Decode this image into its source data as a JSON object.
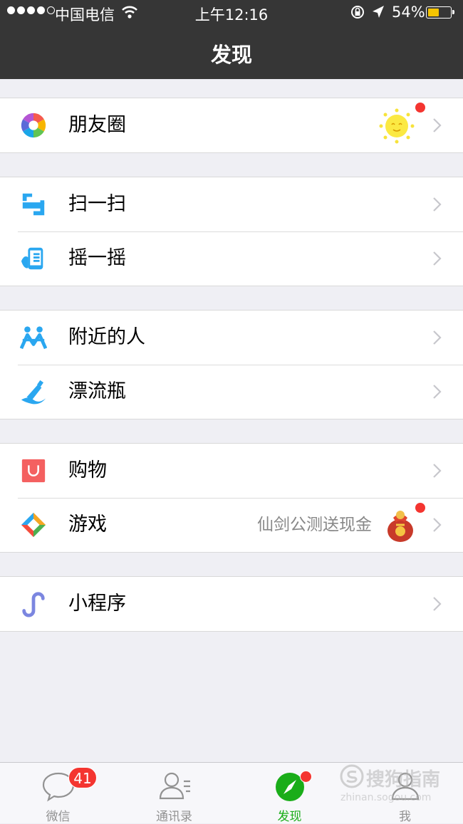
{
  "status_bar": {
    "carrier": "中国电信",
    "time": "上午12:16",
    "battery_percent": "54%",
    "battery_level": 0.54
  },
  "header": {
    "title": "发现"
  },
  "menu": {
    "moments": {
      "label": "朋友圈"
    },
    "scan": {
      "label": "扫一扫"
    },
    "shake": {
      "label": "摇一摇"
    },
    "nearby": {
      "label": "附近的人"
    },
    "bottle": {
      "label": "漂流瓶"
    },
    "shopping": {
      "label": "购物"
    },
    "games": {
      "label": "游戏",
      "promo": "仙剑公测送现金"
    },
    "miniprogram": {
      "label": "小程序"
    }
  },
  "tabbar": {
    "chats": {
      "label": "微信",
      "badge": "41"
    },
    "contacts": {
      "label": "通讯录"
    },
    "discover": {
      "label": "发现"
    },
    "me": {
      "label": "我"
    }
  },
  "watermark": {
    "brand": "搜狗指南",
    "url": "zhinan.sogou.com"
  },
  "colors": {
    "accent_green": "#1aad19",
    "header_bg": "#363636",
    "badge_red": "#f43530",
    "page_bg": "#efeff4"
  }
}
